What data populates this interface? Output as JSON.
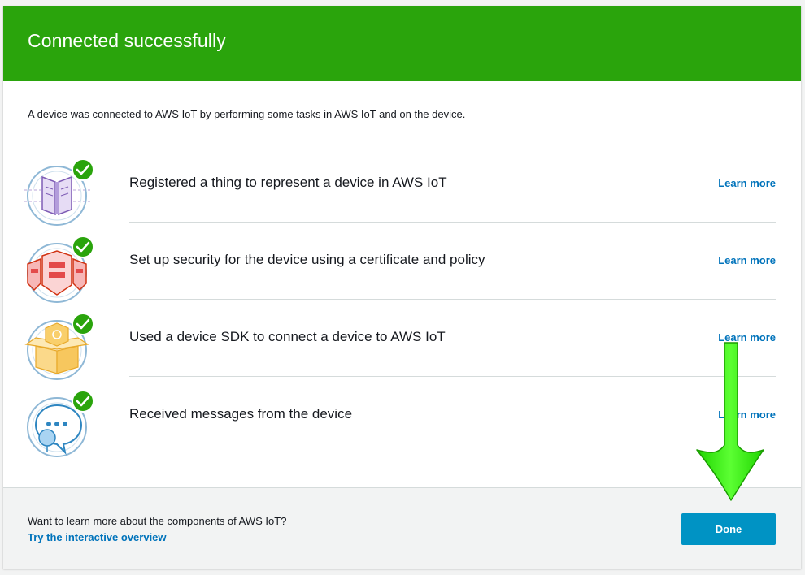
{
  "header": {
    "title": "Connected successfully",
    "color": "#2aa40c"
  },
  "intro": "A device was connected to AWS IoT by performing some tasks in AWS IoT and on the device.",
  "steps": [
    {
      "label": "Registered a thing to represent a device in AWS IoT",
      "link": "Learn more",
      "icon": "book-icon",
      "status": "complete"
    },
    {
      "label": "Set up security for the device using a certificate and policy",
      "link": "Learn more",
      "icon": "security-shield-icon",
      "status": "complete"
    },
    {
      "label": "Used a device SDK to connect a device to AWS IoT",
      "link": "Learn more",
      "icon": "sdk-box-icon",
      "status": "complete"
    },
    {
      "label": "Received messages from the device",
      "link": "Learn more",
      "icon": "message-bubble-icon",
      "status": "complete"
    }
  ],
  "footer": {
    "question": "Want to learn more about the components of AWS IoT?",
    "overview_link": "Try the interactive overview",
    "done_label": "Done"
  },
  "colors": {
    "link": "#0073bb",
    "done_button": "#0093c4",
    "check": "#2aa40c",
    "annotation_arrow": "#33ff00"
  }
}
